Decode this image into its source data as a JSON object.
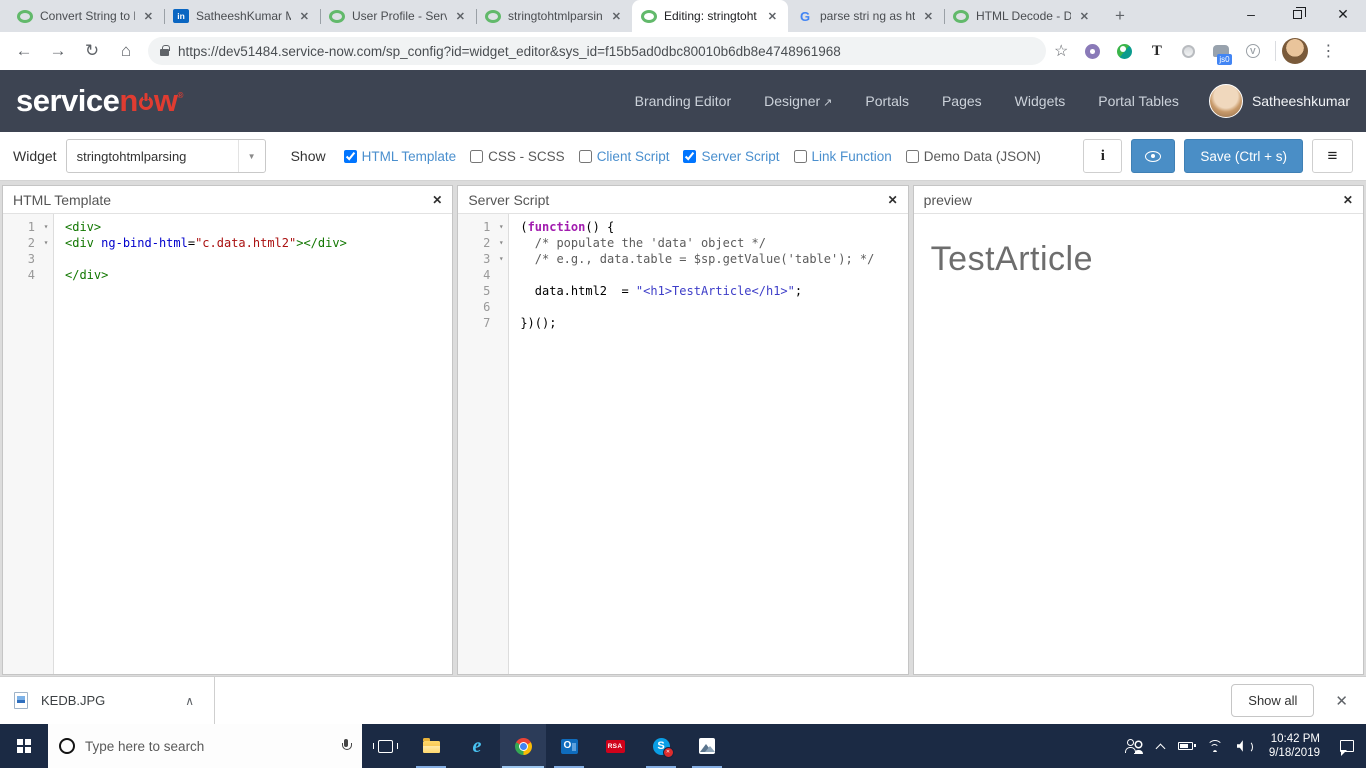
{
  "browser": {
    "tabs": [
      {
        "title": "Convert String to H",
        "icon": "servicenow",
        "active": false
      },
      {
        "title": "SatheeshKumar M",
        "icon": "linkedin",
        "active": false
      },
      {
        "title": "User Profile - Servi",
        "icon": "servicenow",
        "active": false
      },
      {
        "title": "stringtohtmlparsin",
        "icon": "servicenow",
        "active": false
      },
      {
        "title": "Editing: stringtoht",
        "icon": "servicenow",
        "active": true
      },
      {
        "title": "parse stri ng as ht",
        "icon": "google",
        "active": false
      },
      {
        "title": "HTML Decode - D",
        "icon": "servicenow",
        "active": false
      }
    ],
    "new_tab": "+",
    "window": {
      "minimize": "–",
      "close": "✕"
    },
    "url": "https://dev51484.service-now.com/sp_config?id=widget_editor&sys_id=f15b5ad0dbc80010b6db8e4748961968",
    "bookmark_star": "☆",
    "extensions": [
      {
        "name": "gear"
      },
      {
        "name": "webex"
      },
      {
        "name": "letter-t"
      },
      {
        "name": "circle"
      },
      {
        "name": "elephant",
        "badge": "js0"
      },
      {
        "name": "letter-v"
      }
    ],
    "menu_dots": "⋮"
  },
  "sn_header": {
    "logo_white": "service",
    "logo_red_pre": "n",
    "logo_red_post": "w",
    "logo_tm": "®",
    "nav": [
      {
        "label": "Branding Editor"
      },
      {
        "label": "Designer",
        "external": true
      },
      {
        "label": "Portals"
      },
      {
        "label": "Pages"
      },
      {
        "label": "Widgets"
      },
      {
        "label": "Portal Tables"
      }
    ],
    "user_name": "Satheeshkumar"
  },
  "widget_bar": {
    "label": "Widget",
    "widget_value": "stringtohtmlparsing",
    "show_label": "Show",
    "checkboxes": [
      {
        "label": "HTML Template",
        "checked": true,
        "tone": "link"
      },
      {
        "label": "CSS - SCSS",
        "checked": false,
        "tone": "muted"
      },
      {
        "label": "Client Script",
        "checked": false,
        "tone": "link"
      },
      {
        "label": "Server Script",
        "checked": true,
        "tone": "link"
      },
      {
        "label": "Link Function",
        "checked": false,
        "tone": "link"
      },
      {
        "label": "Demo Data (JSON)",
        "checked": false,
        "tone": "muted"
      }
    ],
    "info_label": "i",
    "save_label": "Save (Ctrl + s)"
  },
  "panels": {
    "html_template": {
      "title": "HTML Template",
      "close": "✕",
      "lines": [
        {
          "n": 1,
          "fold": true,
          "tokens": [
            [
              "tag",
              "<div>"
            ]
          ]
        },
        {
          "n": 2,
          "fold": true,
          "tokens": [
            [
              "tag",
              "<div"
            ],
            [
              "plain",
              " "
            ],
            [
              "attr",
              "ng-bind-html"
            ],
            [
              "plain",
              "="
            ],
            [
              "str",
              "\"c.data.html2\""
            ],
            [
              "tag",
              "></div>"
            ]
          ]
        },
        {
          "n": 3,
          "fold": false,
          "tokens": []
        },
        {
          "n": 4,
          "fold": false,
          "tokens": [
            [
              "tag",
              "</div>"
            ]
          ]
        }
      ]
    },
    "server_script": {
      "title": "Server Script",
      "close": "✕",
      "lines": [
        {
          "n": 1,
          "fold": true,
          "tokens": [
            [
              "plain",
              "("
            ],
            [
              "kw",
              "function"
            ],
            [
              "plain",
              "() {"
            ]
          ]
        },
        {
          "n": 2,
          "fold": true,
          "tokens": [
            [
              "plain",
              "  "
            ],
            [
              "cmt",
              "/* populate the 'data' object */"
            ]
          ]
        },
        {
          "n": 3,
          "fold": true,
          "tokens": [
            [
              "plain",
              "  "
            ],
            [
              "cmt",
              "/* e.g., data.table = $sp.getValue('table'); */"
            ]
          ]
        },
        {
          "n": 4,
          "fold": false,
          "tokens": []
        },
        {
          "n": 5,
          "fold": false,
          "tokens": [
            [
              "plain",
              "  data.html2  = "
            ],
            [
              "str2",
              "\"<h1>TestArticle</h1>\""
            ],
            [
              "plain",
              ";"
            ]
          ]
        },
        {
          "n": 6,
          "fold": false,
          "tokens": []
        },
        {
          "n": 7,
          "fold": false,
          "tokens": [
            [
              "plain",
              "})();"
            ]
          ]
        }
      ]
    },
    "preview": {
      "title": "preview",
      "close": "✕",
      "content": "TestArticle"
    }
  },
  "downloads": {
    "file_name": "KEDB.JPG",
    "caret": "∧",
    "show_all": "Show all",
    "close": "✕"
  },
  "taskbar": {
    "search_placeholder": "Type here to search",
    "apps": [
      {
        "name": "task-view",
        "running": false,
        "active": false
      },
      {
        "name": "file-explorer",
        "running": true,
        "active": false
      },
      {
        "name": "internet-explorer",
        "running": false,
        "active": false
      },
      {
        "name": "chrome",
        "running": true,
        "active": true
      },
      {
        "name": "outlook",
        "running": true,
        "active": false
      },
      {
        "name": "rsa",
        "running": false,
        "active": false
      },
      {
        "name": "skype",
        "running": true,
        "active": false
      },
      {
        "name": "photos",
        "running": true,
        "active": false
      }
    ],
    "clock": {
      "time": "10:42 PM",
      "date": "9/18/2019"
    }
  },
  "colors": {
    "accent_blue": "#4a8ec6",
    "link_blue": "#4a8fce",
    "sn_header": "#3d4452",
    "sn_red": "#e03c31",
    "taskbar": "#1b2a44"
  }
}
